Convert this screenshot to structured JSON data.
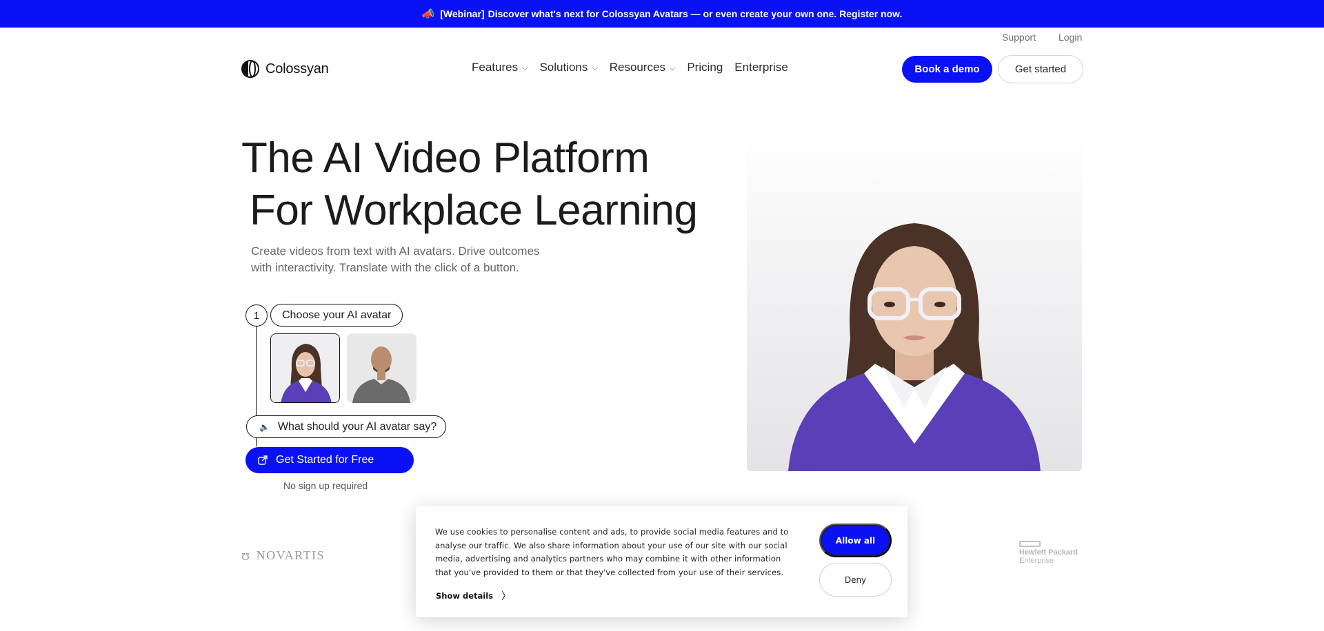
{
  "banner": {
    "emoji": "📣",
    "tag": "[Webinar]",
    "text": "Discover what's next for Colossyan Avatars — or even create your own one. Register now."
  },
  "utility_nav": {
    "support": "Support",
    "login": "Login"
  },
  "brand": {
    "name": "Colossyan"
  },
  "nav": {
    "items": [
      {
        "label": "Features",
        "has_dropdown": true
      },
      {
        "label": "Solutions",
        "has_dropdown": true
      },
      {
        "label": "Resources",
        "has_dropdown": true
      },
      {
        "label": "Pricing",
        "has_dropdown": false
      },
      {
        "label": "Enterprise",
        "has_dropdown": false
      }
    ]
  },
  "header_buttons": {
    "book_demo": "Book a demo",
    "get_started": "Get started"
  },
  "hero": {
    "title_line1": "The AI Video Platform",
    "title_line2": "For Workplace Learning",
    "subtitle": "Create videos from text with AI avatars. Drive outcomes with interactivity. Translate with the click of a button."
  },
  "builder": {
    "step_number": "1",
    "step_label": "Choose your AI avatar",
    "avatars": [
      "female-avatar-glasses",
      "male-avatar-bald"
    ],
    "say_placeholder": "What should your AI avatar say?",
    "cta": "Get Started for Free",
    "cta_note": "No sign up required"
  },
  "logos": {
    "novartis": "NOVARTIS",
    "hpe_line1": "Hewlett Packard",
    "hpe_line2": "Enterprise"
  },
  "cookie_banner": {
    "text": "We use cookies to personalise content and ads, to provide social media features and to analyse our traffic. We also share information about your use of our site with our social media, advertising and analytics partners who may combine it with other information that you've provided to them or that they've collected from your use of their services.",
    "show_details": "Show details",
    "allow_all": "Allow all",
    "deny": "Deny"
  },
  "colors": {
    "brand_blue": "#0a12f5",
    "avatar_sweater": "#5a3fb8"
  }
}
